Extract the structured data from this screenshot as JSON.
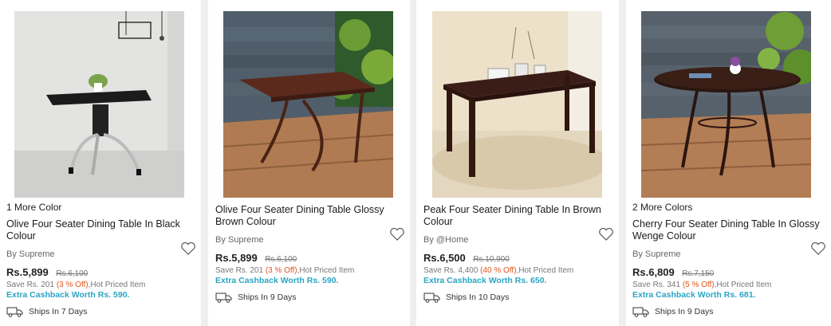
{
  "products": [
    {
      "color_note": "1 More Color",
      "title": "Olive Four Seater Dining Table In Black Colour",
      "brand": "By Supreme",
      "price": "Rs.5,899",
      "mrp": "Rs.6,100",
      "save_prefix": "Save Rs. 201 ",
      "save_pct": "(3 % Off)",
      "save_suffix": ",Hot Priced Item",
      "cashback": "Extra Cashback Worth Rs. 590.",
      "ships": "Ships In 7 Days"
    },
    {
      "color_note": "",
      "title": "Olive Four Seater Dining Table Glossy Brown Colour",
      "brand": "By Supreme",
      "price": "Rs.5,899",
      "mrp": "Rs.6,100",
      "save_prefix": "Save Rs. 201 ",
      "save_pct": "(3 % Off)",
      "save_suffix": ",Hot Priced Item",
      "cashback": "Extra Cashback Worth Rs. 590.",
      "ships": "Ships In 9 Days"
    },
    {
      "color_note": "",
      "title": "Peak Four Seater Dining Table In Brown Colour",
      "brand": "By @Home",
      "price": "Rs.6,500",
      "mrp": "Rs.10,900",
      "save_prefix": "Save Rs. 4,400 ",
      "save_pct": "(40 % Off)",
      "save_suffix": ",Hot Priced Item",
      "cashback": "Extra Cashback Worth Rs. 650.",
      "ships": "Ships In 10 Days"
    },
    {
      "color_note": "2 More Colors",
      "title": "Cherry Four Seater Dining Table In Glossy Wenge Colour",
      "brand": "By Supreme",
      "price": "Rs.6,809",
      "mrp": "Rs.7,150",
      "save_prefix": "Save Rs. 341 ",
      "save_pct": "(5 % Off)",
      "save_suffix": ",Hot Priced Item",
      "cashback": "Extra Cashback Worth Rs. 681.",
      "ships": "Ships In 9 Days"
    }
  ],
  "icons": {
    "wishlist": "heart-outline-icon",
    "shipping": "truck-icon"
  },
  "colors": {
    "discount": "#e2531d",
    "cashback": "#29a5c4"
  }
}
